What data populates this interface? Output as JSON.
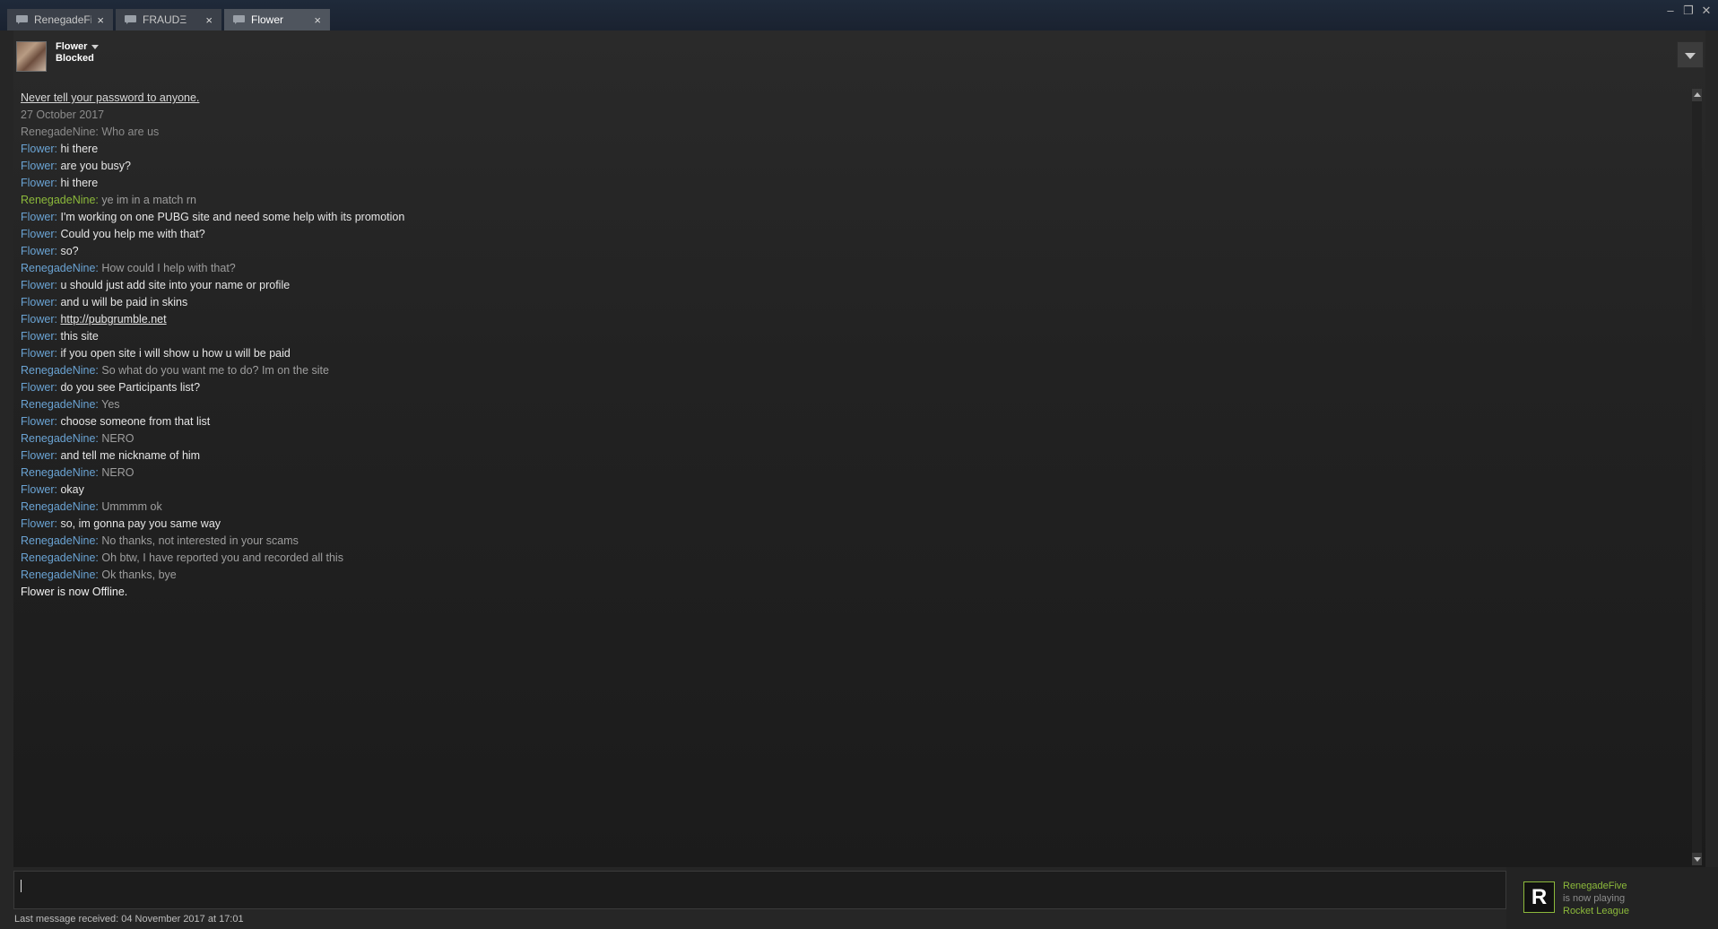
{
  "tabs": [
    {
      "label": "RenegadeFive",
      "close": "×",
      "active": false
    },
    {
      "label": "FRAUDΞ",
      "close": "×",
      "active": false
    },
    {
      "label": "Flower",
      "close": "×",
      "active": true
    }
  ],
  "window_controls": {
    "minimize": "–",
    "restore": "❐",
    "close": "✕"
  },
  "header": {
    "friend_name": "Flower",
    "friend_status": "Blocked"
  },
  "chat": {
    "warning": "Never tell your password to anyone.",
    "date": "27 October 2017",
    "messages": [
      {
        "sender": "RenegadeNine",
        "text": "Who are us"
      },
      {
        "sender": "Flower",
        "text": "hi there"
      },
      {
        "sender": "Flower",
        "text": "are you busy?"
      },
      {
        "sender": "Flower",
        "text": "hi there"
      },
      {
        "sender": "RenegadeNine",
        "text": "ye im in a match rn"
      },
      {
        "sender": "Flower",
        "text": "I'm working on one PUBG site and need some help with its promotion"
      },
      {
        "sender": "Flower",
        "text": "Could you help me with that?"
      },
      {
        "sender": "Flower",
        "text": "so?"
      },
      {
        "sender": "RenegadeNine",
        "text": "How could I help with that?"
      },
      {
        "sender": "Flower",
        "text": "u should just add site into your name or profile"
      },
      {
        "sender": "Flower",
        "text": "and u will be paid in skins"
      },
      {
        "sender": "Flower",
        "text": "http://pubgrumble.net"
      },
      {
        "sender": "Flower",
        "text": "this site"
      },
      {
        "sender": "Flower",
        "text": "if you open site i will show u how u will be paid"
      },
      {
        "sender": "RenegadeNine",
        "text": "So what do you want me to do? Im on the site"
      },
      {
        "sender": "Flower",
        "text": "do you see Participants list?"
      },
      {
        "sender": "RenegadeNine",
        "text": "Yes"
      },
      {
        "sender": "Flower",
        "text": "choose someone from that list"
      },
      {
        "sender": "RenegadeNine",
        "text": "NERO"
      },
      {
        "sender": "Flower",
        "text": "and tell me nickname of him"
      },
      {
        "sender": "RenegadeNine",
        "text": "NERO"
      },
      {
        "sender": "Flower",
        "text": "okay"
      },
      {
        "sender": "RenegadeNine",
        "text": "Ummmm ok"
      },
      {
        "sender": "Flower",
        "text": "so, im gonna pay you same way"
      },
      {
        "sender": "RenegadeNine",
        "text": "No thanks, not interested in your scams"
      },
      {
        "sender": "RenegadeNine",
        "text": "Oh btw, I have reported you and recorded all this"
      },
      {
        "sender": "RenegadeNine",
        "text": "Ok thanks, bye"
      }
    ],
    "separator": ": ",
    "system": "Flower is now Offline."
  },
  "input": {
    "value": ""
  },
  "footer": {
    "last_message": "Last message received: 04 November 2017 at 17:01"
  },
  "toast": {
    "logo": "R",
    "name": "RenegadeFive",
    "status": "is now playing",
    "game": "Rocket League"
  },
  "colors": {
    "flower": "#6aa3d3",
    "renegade_blue": "#6aa3d3",
    "renegade_green": "#8cb93b",
    "gray": "#8c8c8c",
    "accent_green": "#8cb93b"
  }
}
